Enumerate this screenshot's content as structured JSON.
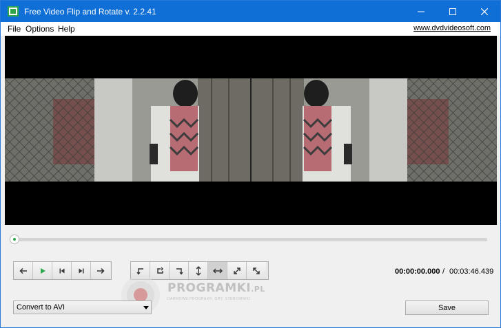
{
  "window": {
    "title": "Free Video Flip and Rotate v. 2.2.41",
    "accent_color": "#0f6fd6"
  },
  "titlebar_controls": {
    "minimize_icon": "minimize-icon",
    "maximize_icon": "maximize-icon",
    "close_icon": "close-icon"
  },
  "menu": {
    "file": "File",
    "options": "Options",
    "help": "Help",
    "site_link": "www.dvdvideosoft.com"
  },
  "playback": {
    "position": 0.0,
    "current_time": "00:00:00.000",
    "separator": "/",
    "total_time": "00:03:46.439"
  },
  "nav_buttons": [
    {
      "icon": "arrow-left-icon"
    },
    {
      "icon": "play-icon"
    },
    {
      "icon": "skip-start-icon"
    },
    {
      "icon": "skip-end-icon"
    },
    {
      "icon": "arrow-right-icon"
    }
  ],
  "rotate_buttons": [
    {
      "icon": "rotate-left-icon"
    },
    {
      "icon": "rotate-right-icon"
    },
    {
      "icon": "turn-down-icon"
    },
    {
      "icon": "flip-vertical-icon"
    },
    {
      "icon": "flip-horizontal-icon",
      "active": true
    },
    {
      "icon": "diagonal-expand-icon"
    },
    {
      "icon": "diagonal-shrink-icon"
    }
  ],
  "output": {
    "format": "Convert to AVI",
    "save_label": "Save"
  },
  "watermark": {
    "title": "PROGRAMKI",
    "suffix": ".PL",
    "subtitle": "DARMOWE PROGRAMY, GRY, STEROWNIKI"
  }
}
